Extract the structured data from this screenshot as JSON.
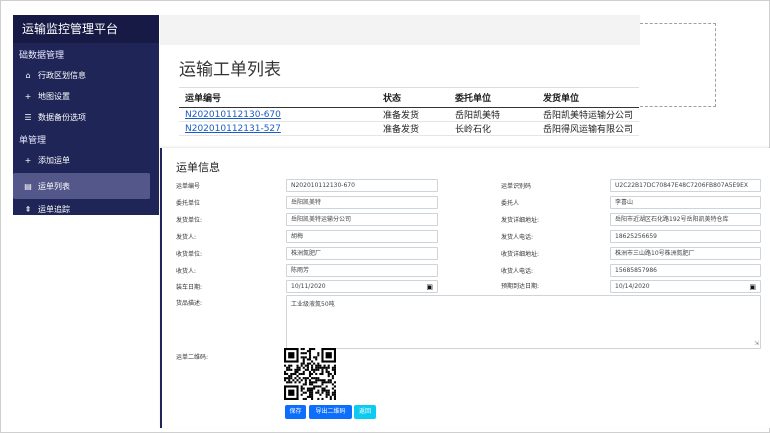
{
  "sidebar": {
    "brand": "运输监控管理平台",
    "groups": [
      {
        "label": "础数据管理"
      },
      {
        "label": "单管理"
      }
    ],
    "items": [
      {
        "icon": "home-icon",
        "glyph": "🏠",
        "label": "行政区划信息"
      },
      {
        "icon": "plus-icon",
        "glyph": "+",
        "label": "地图设置"
      },
      {
        "icon": "list-icon",
        "glyph": "☰",
        "label": "数据备份选项"
      },
      {
        "icon": "plus-icon",
        "glyph": "+",
        "label": "添加运单"
      },
      {
        "icon": "table-icon",
        "glyph": "▤",
        "label": "运单列表"
      },
      {
        "icon": "pin-icon",
        "glyph": "⇞",
        "label": "运单追踪"
      }
    ]
  },
  "list": {
    "title": "运输工单列表",
    "columns": [
      "运单编号",
      "状态",
      "委托单位",
      "发货单位"
    ],
    "rows": [
      [
        "N202010112130-670",
        "准备发货",
        "岳阳凯美特",
        "岳阳凯美特运输分公司"
      ],
      [
        "N202010112131-527",
        "准备发货",
        "长岭石化",
        "岳阳得风运输有限公司"
      ]
    ]
  },
  "form": {
    "title": "运单信息",
    "fields": {
      "waybill_no": {
        "label": "运单编号",
        "value": "N202010112130-670"
      },
      "waybill_id": {
        "label": "运单识别码",
        "value": "U2C22B17DC70847E48C7206FB807A5E9EX"
      },
      "client_unit": {
        "label": "委托单位",
        "value": "岳阳凯美特"
      },
      "client_person": {
        "label": "委托人",
        "value": "李喜山"
      },
      "ship_unit": {
        "label": "发货单位:",
        "value": "岳阳凯美特运输分公司"
      },
      "ship_address": {
        "label": "发货详细地址:",
        "value": "岳阳市近湖区石化路192号岳阳凯美特仓库"
      },
      "shipper": {
        "label": "发货人:",
        "value": "胡梅"
      },
      "shipper_phone": {
        "label": "发货人电话:",
        "value": "18625256659"
      },
      "recv_unit": {
        "label": "收货单位:",
        "value": "株洲氮肥厂"
      },
      "recv_address": {
        "label": "收货详细地址:",
        "value": "株洲市三山路10号株洲氮肥厂"
      },
      "receiver": {
        "label": "收货人:",
        "value": "陈雨芳"
      },
      "receiver_phone": {
        "label": "收货人电话:",
        "value": "15685857986"
      },
      "load_date": {
        "label": "装车日期:",
        "value": "10/11/2020"
      },
      "arrive_date": {
        "label": "预期到达日期:",
        "value": "10/14/2020"
      },
      "goods_desc": {
        "label": "货品描述:",
        "value": "工业级液氮50吨"
      },
      "qr_label": {
        "label": "运单二维码:"
      }
    },
    "buttons": {
      "save": "保存",
      "export_qr": "导出二维码",
      "back": "返回"
    }
  },
  "colors": {
    "sidebar_bg": "#1f2557",
    "link": "#1a5cc7",
    "primary": "#0d6efd",
    "info": "#0dcaf0"
  }
}
